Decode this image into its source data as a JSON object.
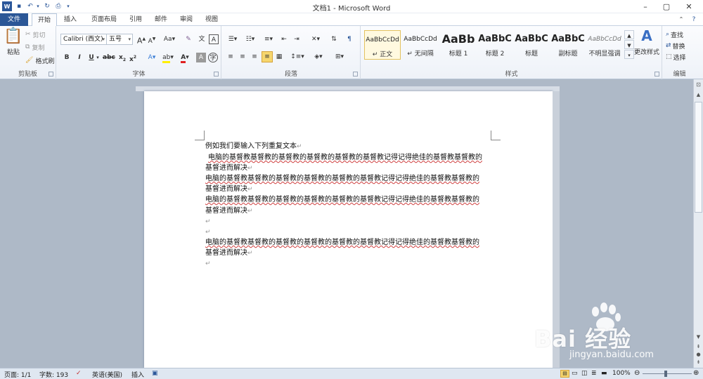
{
  "window": {
    "title": "文档1 - Microsoft Word",
    "controls": [
      "–",
      "▢",
      "✕"
    ]
  },
  "tabs": [
    "文件",
    "开始",
    "插入",
    "页面布局",
    "引用",
    "邮件",
    "审阅",
    "视图"
  ],
  "ribbon": {
    "clipboard": {
      "label": "剪贴板",
      "paste": "粘贴",
      "cut": "剪切",
      "copy": "复制",
      "format_painter": "格式刷"
    },
    "font": {
      "label": "字体",
      "font_name": "Calibri (西文)",
      "font_size": "五号"
    },
    "paragraph": {
      "label": "段落"
    },
    "styles": {
      "label": "样式",
      "items": [
        {
          "preview": "AaBbCcDd",
          "name": "↵ 正文"
        },
        {
          "preview": "AaBbCcDd",
          "name": "↵ 无间隔"
        },
        {
          "preview": "AaBb",
          "name": "标题 1"
        },
        {
          "preview": "AaBbC",
          "name": "标题 2"
        },
        {
          "preview": "AaBbC",
          "name": "标题"
        },
        {
          "preview": "AaBbC",
          "name": "副标题"
        },
        {
          "preview": "AaBbCcDd",
          "name": "不明显强调"
        }
      ],
      "change_styles": "更改样式"
    },
    "editing": {
      "label": "编辑",
      "find": "查找",
      "replace": "替换",
      "select": "选择"
    }
  },
  "document": {
    "lines": [
      "例如我们要输入下列重复文本",
      "电脑的基督教基督教的基督教的基督教的基督教的基督教记得记得绝佳的基督教基督教的",
      "基督进而解决",
      "电脑的基督教基督教的基督教的基督教的基督教的基督教记得记得绝佳的基督教基督教的",
      "基督进而解决",
      "电脑的基督教基督教的基督教的基督教的基督教的基督教记得记得绝佳的基督教基督教的",
      "基督进而解决",
      "",
      "",
      "电脑的基督教基督教的基督教的基督教的基督教的基督教记得记得绝佳的基督教基督教的",
      "基督进而解决",
      ""
    ]
  },
  "status": {
    "page": "页面: 1/1",
    "words": "字数: 193",
    "language": "英语(美国)",
    "mode": "插入",
    "zoom": "100%"
  },
  "watermark": {
    "brand": "Bai 经验",
    "url": "jingyan.baidu.com"
  },
  "colors": {
    "file_tab": "#2b5797",
    "accent": "#2b579a"
  }
}
